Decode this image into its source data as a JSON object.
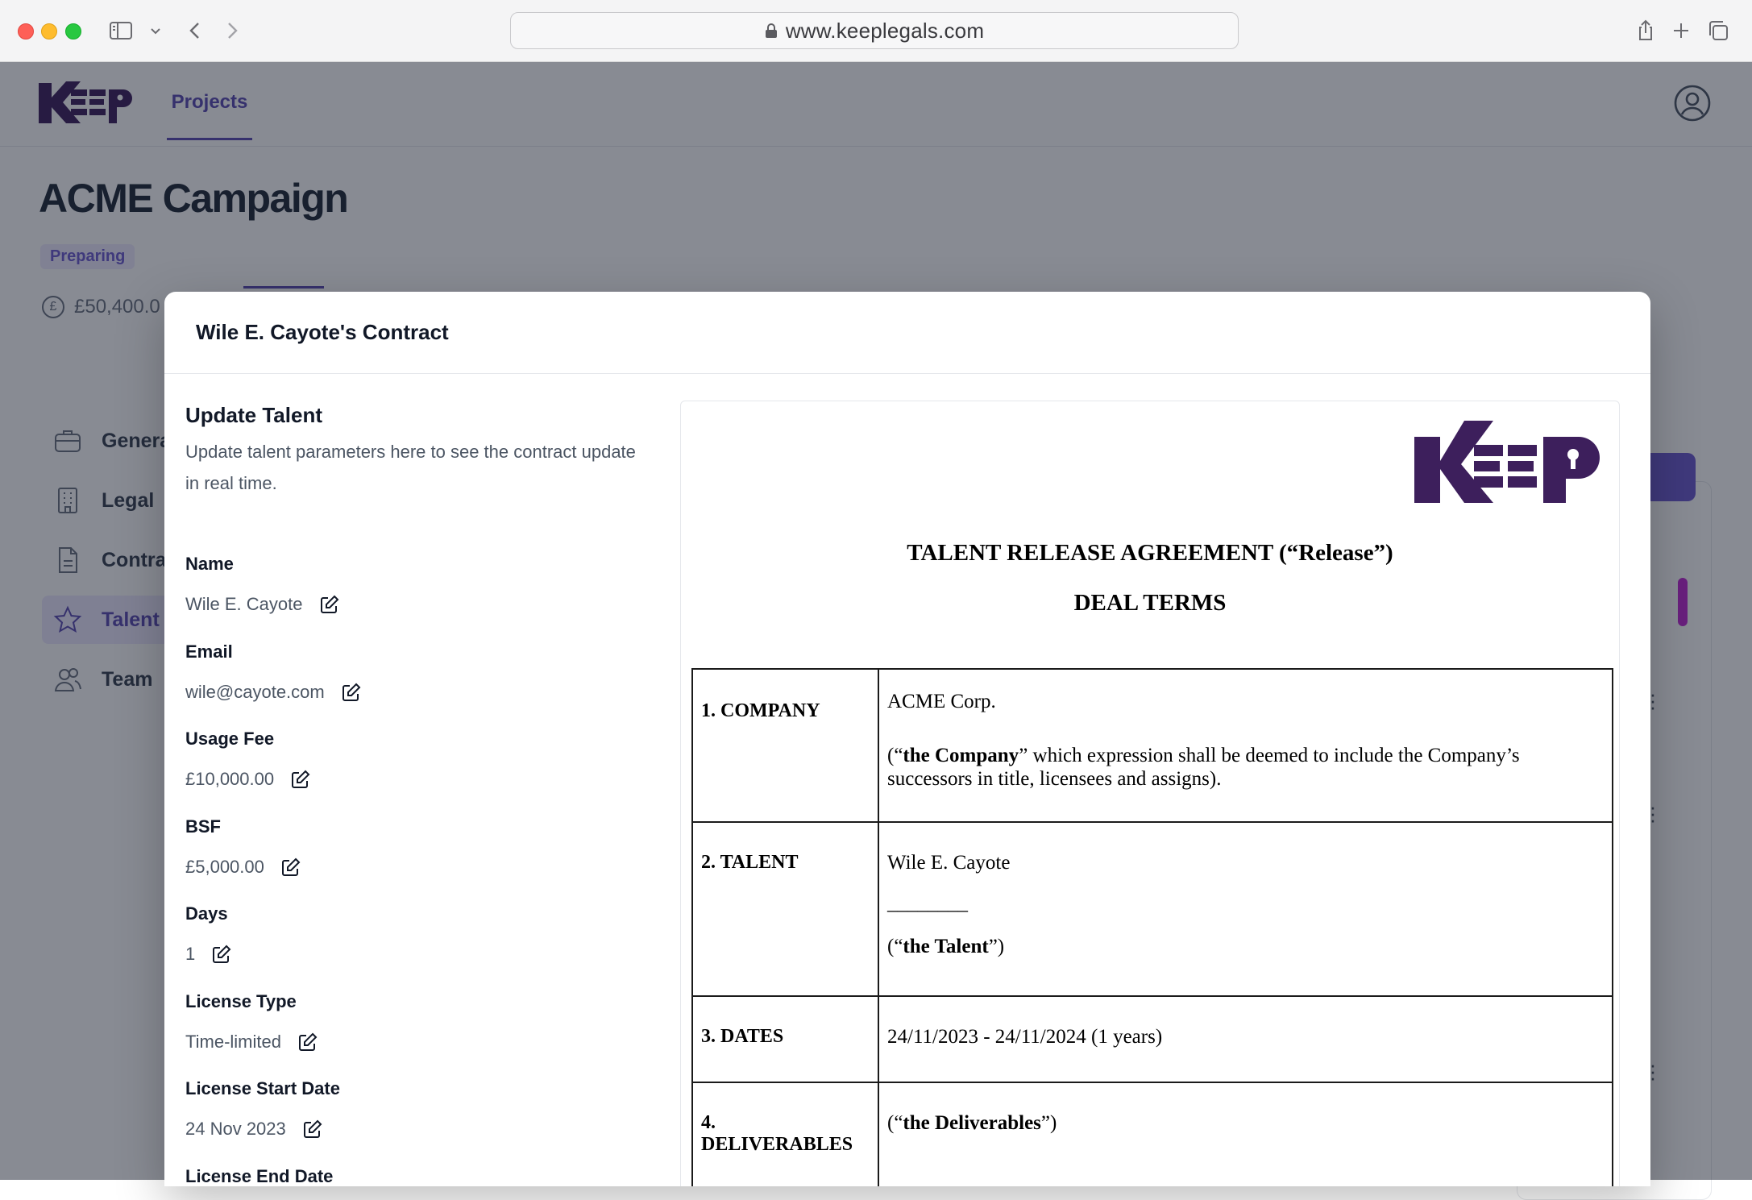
{
  "browser": {
    "url": "www.keeplegals.com"
  },
  "app": {
    "nav": {
      "projects": "Projects"
    },
    "project_title": "ACME Campaign",
    "status": "Preparing",
    "budget": "£50,400.0",
    "sidebar": [
      {
        "label": "General",
        "icon": "briefcase-icon"
      },
      {
        "label": "Legal",
        "icon": "building-icon"
      },
      {
        "label": "Contracts",
        "icon": "document-icon"
      },
      {
        "label": "Talent",
        "icon": "star-icon"
      },
      {
        "label": "Team",
        "icon": "users-icon"
      }
    ],
    "brand_color": "#3d1f5c",
    "accent_color": "#5b4bb3"
  },
  "modal": {
    "title": "Wile E. Cayote's Contract",
    "section_title": "Update Talent",
    "section_desc": "Update talent parameters here to see the contract update in real time.",
    "fields": [
      {
        "label": "Name",
        "value": "Wile E. Cayote"
      },
      {
        "label": "Email",
        "value": "wile@cayote.com"
      },
      {
        "label": "Usage Fee",
        "value": "£10,000.00"
      },
      {
        "label": "BSF",
        "value": "£5,000.00"
      },
      {
        "label": "Days",
        "value": "1"
      },
      {
        "label": "License Type",
        "value": "Time-limited"
      },
      {
        "label": "License Start Date",
        "value": "24 Nov 2023"
      },
      {
        "label": "License End Date",
        "value": ""
      }
    ]
  },
  "document": {
    "logo_text": "KEEP",
    "title": "TALENT RELEASE AGREEMENT (“Release”)",
    "subtitle": "DEAL TERMS",
    "rows": {
      "company": {
        "label": "1. COMPANY",
        "name": "ACME Corp.",
        "def_open": "(“",
        "def_bold": "the Company",
        "def_rest": "” which expression shall be deemed to include the Company’s successors in title, licensees and assigns)."
      },
      "talent": {
        "label": "2. TALENT",
        "name": "Wile E. Cayote",
        "blank": "________",
        "def_open": "(“",
        "def_bold": "the Talent",
        "def_close": "”)"
      },
      "dates": {
        "label": "3. DATES",
        "value": "24/11/2023 - 24/11/2024 (1 years)"
      },
      "deliverables": {
        "label": "4. DELIVERABLES",
        "def_open": "(“",
        "def_bold": "the Deliverables",
        "def_close": "”)"
      }
    }
  }
}
